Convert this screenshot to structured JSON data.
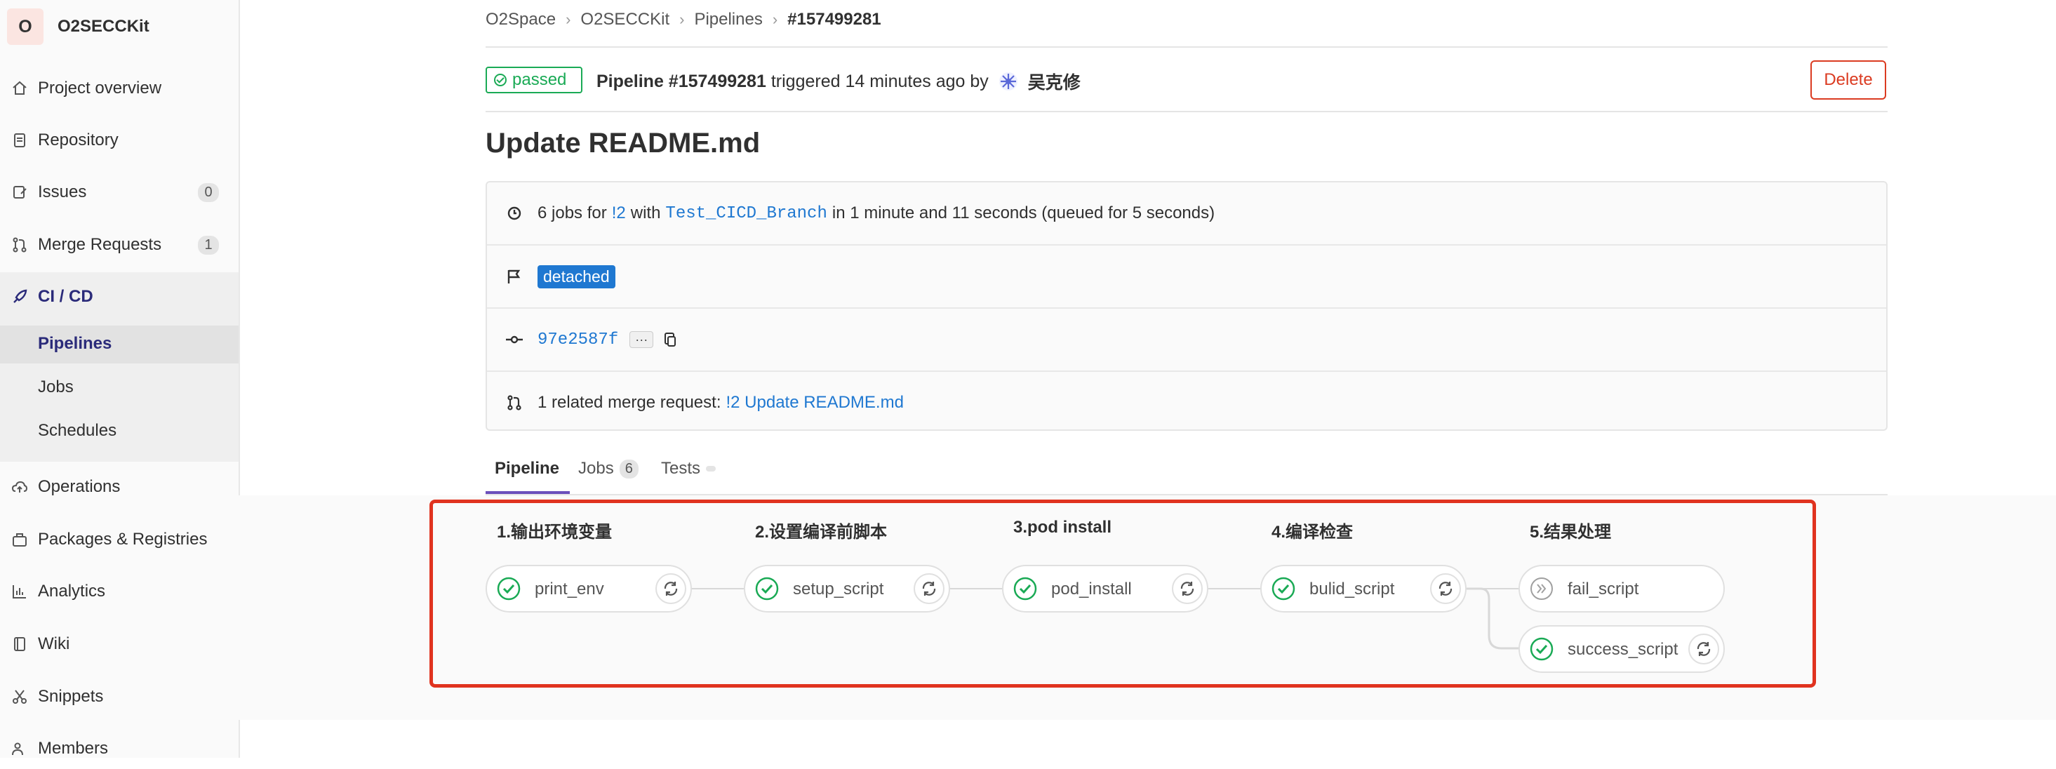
{
  "sidebar": {
    "project_initial": "O",
    "project_name": "O2SECCKit",
    "items": [
      {
        "label": "Project overview",
        "icon": "home-icon"
      },
      {
        "label": "Repository",
        "icon": "doc-icon"
      },
      {
        "label": "Issues",
        "icon": "issues-icon",
        "count": "0"
      },
      {
        "label": "Merge Requests",
        "icon": "merge-request-icon",
        "count": "1"
      },
      {
        "label": "CI / CD",
        "icon": "rocket-icon"
      },
      {
        "label": "Operations",
        "icon": "cloud-icon"
      },
      {
        "label": "Packages & Registries",
        "icon": "package-icon"
      },
      {
        "label": "Analytics",
        "icon": "chart-icon"
      },
      {
        "label": "Wiki",
        "icon": "book-icon"
      },
      {
        "label": "Snippets",
        "icon": "scissors-icon"
      },
      {
        "label": "Members",
        "icon": "users-icon"
      }
    ],
    "cicd_sub": [
      "Pipelines",
      "Jobs",
      "Schedules"
    ]
  },
  "breadcrumb": [
    "O2Space",
    "O2SECCKit",
    "Pipelines",
    "#157499281"
  ],
  "header": {
    "status": "passed",
    "pipeline_label": "Pipeline #157499281",
    "triggered": "triggered 14 minutes ago by",
    "user": "吴克修",
    "delete_label": "Delete"
  },
  "title": "Update README.md",
  "info": {
    "jobs_count": "6 jobs for",
    "mr_ref": "!2",
    "with": "with",
    "branch": "Test_CICD_Branch",
    "duration": "in 1 minute and 11 seconds (queued for 5 seconds)",
    "tag": "detached",
    "commit": "97e2587f",
    "ellipsis": "···",
    "related_text": "1 related merge request:",
    "related_link": "!2 Update README.md"
  },
  "tabs": [
    {
      "label": "Pipeline"
    },
    {
      "label": "Jobs",
      "count": "6"
    },
    {
      "label": "Tests"
    }
  ],
  "stages": [
    {
      "title": "1.输出环境变量",
      "jobs": [
        {
          "name": "print_env",
          "status": "success"
        }
      ]
    },
    {
      "title": "2.设置编译前脚本",
      "jobs": [
        {
          "name": "setup_script",
          "status": "success"
        }
      ]
    },
    {
      "title": "3.pod install",
      "jobs": [
        {
          "name": "pod_install",
          "status": "success"
        }
      ]
    },
    {
      "title": "4.编译检查",
      "jobs": [
        {
          "name": "bulid_script",
          "status": "success"
        }
      ]
    },
    {
      "title": "5.结果处理",
      "jobs": [
        {
          "name": "fail_script",
          "status": "skipped"
        },
        {
          "name": "success_script",
          "status": "success"
        }
      ]
    }
  ],
  "colors": {
    "success": "#1aaa55",
    "danger": "#db3b21",
    "link": "#1f78d1",
    "tab_active": "#6b4fbb",
    "highlight_box": "#e0331f"
  }
}
